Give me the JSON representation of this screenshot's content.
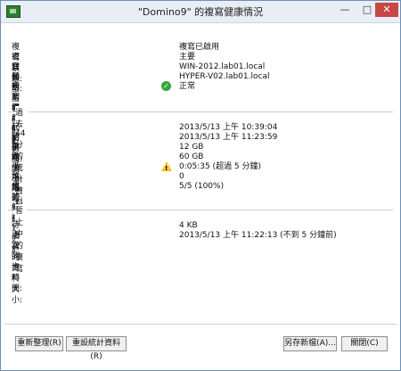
{
  "window": {
    "title": "\"Domino9\" 的複寫健康情況"
  },
  "status": [
    {
      "label": "複寫狀態:",
      "value": "複寫已啟用"
    },
    {
      "label": "複寫類型:",
      "value": "主要"
    },
    {
      "label": "目前的主要伺服器:",
      "value": "WIN-2012.lab01.local"
    },
    {
      "label": "目前的複本伺服器:",
      "value": "HYPER-V02.lab01.local"
    },
    {
      "label": "複寫健康情況:",
      "value": "正常",
      "icon": "ok-icon"
    }
  ],
  "stats_section": {
    "title": "過去 44 分的統計資料",
    "rows": [
      {
        "label": "起始時間:",
        "value": "2013/5/13 上午 10:39:04"
      },
      {
        "label": "結束時間:",
        "value": "2013/5/13 上午 11:23:59"
      },
      {
        "label": "平均大小:",
        "value": "12 GB"
      },
      {
        "label": "大小上限:",
        "value": "60 GB"
      },
      {
        "label": "平均延遲:",
        "value": "0:05:35  (超過 5 分鐘)",
        "icon": "warning-icon"
      },
      {
        "label": "發生的錯誤:",
        "value": "0"
      },
      {
        "label": "成功的複寫週期:",
        "value": "5/5 (100%)"
      }
    ]
  },
  "pending_section": {
    "title": "暫止中的複寫",
    "rows": [
      {
        "label": "待複寫的資料大小:",
        "value": "4 KB"
      },
      {
        "label": "上次同步時間:",
        "value": "2013/5/13 上午 11:22:13 (不到 5 分鐘前)"
      }
    ]
  },
  "buttons": {
    "refresh": "重新整理(R)",
    "reset": "重設統計資料(R)",
    "save_as": "另存新檔(A)...",
    "close": "關閉(C)"
  }
}
